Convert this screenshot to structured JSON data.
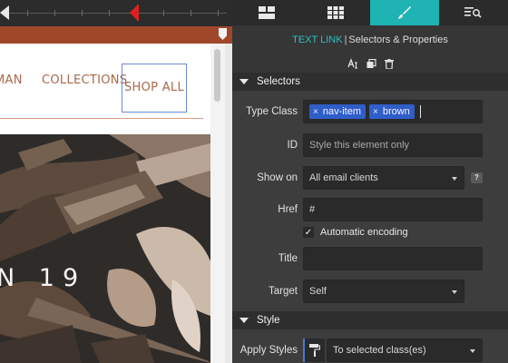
{
  "canvas": {
    "nav_items": [
      "MAN",
      "COLLECTIONS",
      "SHOP ALL"
    ],
    "hero_text": "N  19"
  },
  "panel": {
    "tabs": [
      {
        "icon": "layout-icon"
      },
      {
        "icon": "grid-icon"
      },
      {
        "icon": "brush-icon",
        "active": true
      },
      {
        "icon": "search-list-icon"
      }
    ],
    "context_element": "TEXT LINK",
    "context_separator": "|",
    "context_title": "Selectors & Properties",
    "tools": [
      "text-style-icon",
      "copy-icon",
      "trash-icon"
    ]
  },
  "selectors": {
    "header": "Selectors",
    "type_class_label": "Type Class",
    "classes": [
      "nav-item",
      "brown"
    ],
    "tag_remove": "×",
    "id_label": "ID",
    "id_placeholder": "Style this element only",
    "show_on_label": "Show on",
    "show_on_value": "All email clients",
    "help_label": "?",
    "href_label": "Href",
    "href_value": "#",
    "auto_encoding_label": "Automatic encoding",
    "auto_encoding_checked": true,
    "checkmark": "✓",
    "title_label": "Title",
    "title_value": "",
    "target_label": "Target",
    "target_value": "Self"
  },
  "style": {
    "header": "Style",
    "apply_styles_label": "Apply Styles",
    "apply_styles_value": "To selected class(es)"
  },
  "colors": {
    "accent": "#20b3b3",
    "nav_text": "#a8694a",
    "tag_bg": "#2f5ec9",
    "rule_bar": "#a0472a",
    "timeline_marker": "#e02020"
  }
}
